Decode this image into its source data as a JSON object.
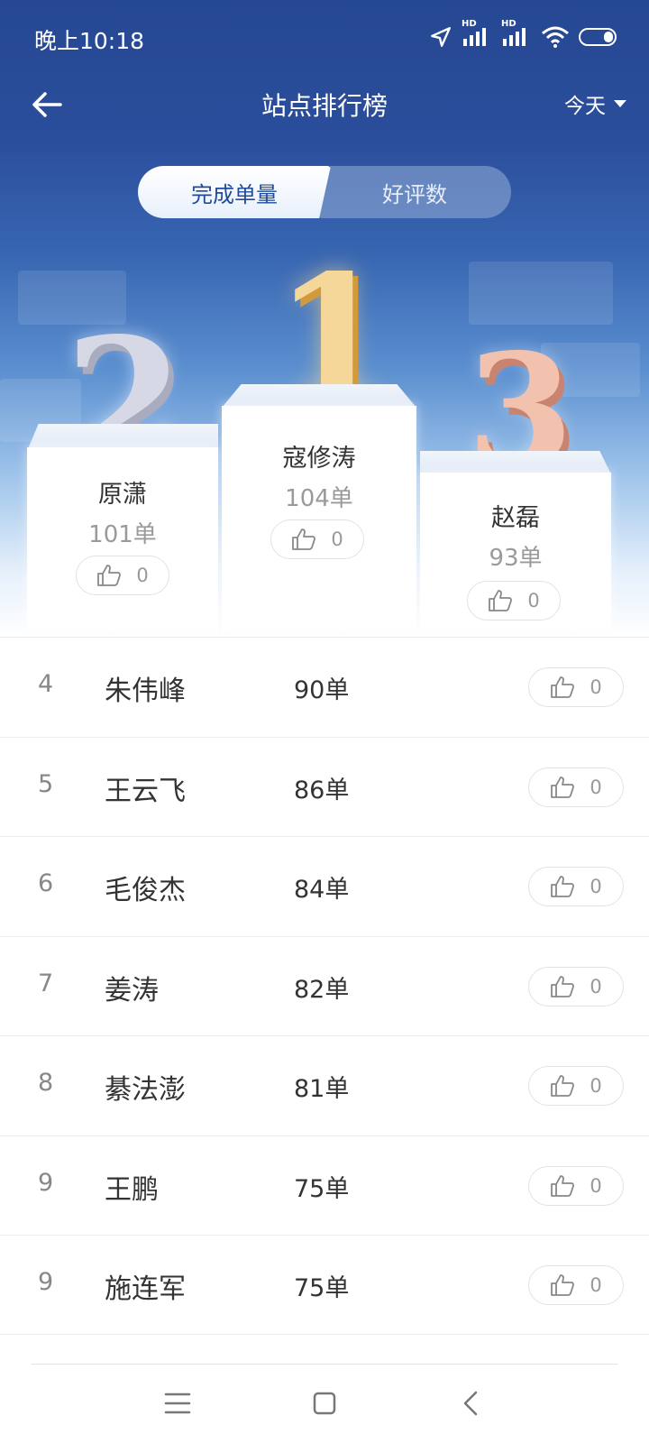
{
  "status_bar": {
    "time": "晚上10:18",
    "hd1": "HD",
    "hd2": "HD"
  },
  "header": {
    "title": "站点排行榜",
    "period": "今天"
  },
  "tabs": [
    {
      "label": "完成单量",
      "active": true
    },
    {
      "label": "好评数",
      "active": false
    }
  ],
  "podium": {
    "first": {
      "rank": "1",
      "name": "寇修涛",
      "count": "104单",
      "likes": "0"
    },
    "second": {
      "rank": "2",
      "name": "原潇",
      "count": "101单",
      "likes": "0"
    },
    "third": {
      "rank": "3",
      "name": "赵磊",
      "count": "93单",
      "likes": "0"
    }
  },
  "rows": [
    {
      "rank": "4",
      "name": "朱伟峰",
      "count": "90单",
      "likes": "0"
    },
    {
      "rank": "5",
      "name": "王云飞",
      "count": "86单",
      "likes": "0"
    },
    {
      "rank": "6",
      "name": "毛俊杰",
      "count": "84单",
      "likes": "0"
    },
    {
      "rank": "7",
      "name": "姜涛",
      "count": "82单",
      "likes": "0"
    },
    {
      "rank": "8",
      "name": "綦法澎",
      "count": "81单",
      "likes": "0"
    },
    {
      "rank": "9",
      "name": "王鹏",
      "count": "75单",
      "likes": "0"
    },
    {
      "rank": "9",
      "name": "施连军",
      "count": "75单",
      "likes": "0"
    }
  ],
  "colors": {
    "header_bg": "#264893",
    "tab_active_text": "#1f4b9a"
  }
}
